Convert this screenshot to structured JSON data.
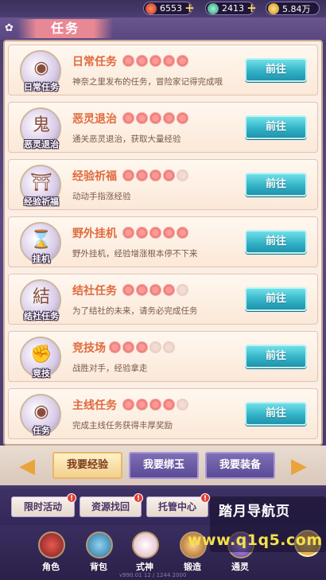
{
  "resources": [
    {
      "icon": "fire-orb-icon",
      "value": "6553"
    },
    {
      "icon": "jade-icon",
      "value": "2413"
    },
    {
      "icon": "coin-icon",
      "value": "5.84万"
    }
  ],
  "header": {
    "title": "任务"
  },
  "tasks": [
    {
      "name": "日常任务",
      "badge": "日常任务",
      "icon": "daily-orb-icon",
      "desc": "神奈之里发布的任务，冒险家记得完成哦",
      "stars": 5,
      "stars_total": 5,
      "button": "前往"
    },
    {
      "name": "恶灵退治",
      "badge": "恶灵退治",
      "icon": "exp-demon-icon",
      "desc": "通关恶灵退治，获取大量经验",
      "stars": 5,
      "stars_total": 5,
      "button": "前往"
    },
    {
      "name": "经验祈福",
      "badge": "经验祈福",
      "icon": "torii-gate-icon",
      "desc": "动动手指涨经验",
      "stars": 4,
      "stars_total": 5,
      "button": "前往"
    },
    {
      "name": "野外挂机",
      "badge": "挂机",
      "icon": "hourglass-icon",
      "desc": "野外挂机，经验增涨根本停不下来",
      "stars": 5,
      "stars_total": 5,
      "button": "前往"
    },
    {
      "name": "结社任务",
      "badge": "结社任务",
      "icon": "guild-lantern-icon",
      "desc": "为了结社的未来，请务必完成任务",
      "stars": 4,
      "stars_total": 5,
      "button": "前往"
    },
    {
      "name": "竞技场",
      "badge": "竞技",
      "icon": "arena-glove-icon",
      "desc": "战胜对手，经验拿走",
      "stars": 3,
      "stars_total": 5,
      "button": "前往"
    },
    {
      "name": "主线任务",
      "badge": "任务",
      "icon": "mainline-orb-icon",
      "desc": "完成主线任务获得丰厚奖励",
      "stars": 4,
      "stars_total": 5,
      "button": "前往"
    }
  ],
  "tabs": [
    {
      "label": "我要经验",
      "active": true
    },
    {
      "label": "我要绑玉",
      "active": false
    },
    {
      "label": "我要装备",
      "active": false
    }
  ],
  "nav": [
    {
      "label": "限时活动",
      "alert": "!"
    },
    {
      "label": "资源找回",
      "alert": "!"
    },
    {
      "label": "托管中心",
      "alert": "!"
    }
  ],
  "watermark": {
    "line1": "踏月导航页",
    "line2": "www.q1q5.com"
  },
  "dock": [
    {
      "label": "角色",
      "icon": "helmet-icon"
    },
    {
      "label": "背包",
      "icon": "bag-icon"
    },
    {
      "label": "式神",
      "icon": "fox-mask-icon"
    },
    {
      "label": "锻造",
      "icon": "anvil-icon"
    },
    {
      "label": "通灵",
      "icon": "spirit-icon"
    }
  ],
  "version": "v990.01 12 / 1244 2000",
  "colors": {
    "accent": "#34b3c7",
    "task_title": "#e06a3e",
    "star_on": "#e9736f",
    "star_off": "#e7c6bd"
  }
}
